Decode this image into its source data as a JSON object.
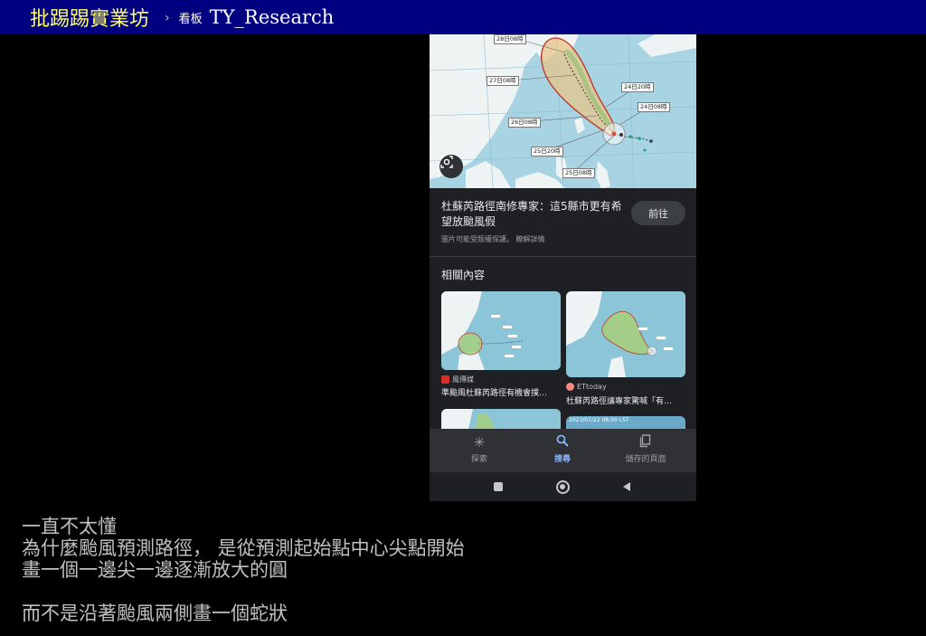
{
  "header": {
    "site_name": "批踢踢實業坊",
    "separator": "›",
    "board_label": "看板",
    "board_name": "TY_Research"
  },
  "phone_screenshot": {
    "map_labels": [
      "28日08時",
      "27日08時",
      "24日20時",
      "24日08時",
      "26日08時",
      "25日20時",
      "25日08時"
    ],
    "result_title": "杜蘇芮路徑南修專家：這5縣市更有希望放颱風假",
    "go_button": "前往",
    "copyright_note": "圖片可能受版權保護。 瞭解詳情",
    "related_heading": "相關內容",
    "cards": [
      {
        "source": "風傳媒",
        "title": "準颱風杜蘇芮路徑有機會撲…",
        "source_color": "#d93025"
      },
      {
        "source": "ETtoday",
        "title": "杜蘇芮路徑讓專家驚喊「有…",
        "source_color": "#f28b82"
      }
    ],
    "partial_card_text": "2023/07/22 08:00 LST",
    "bottom_nav": [
      {
        "label": "探索",
        "icon": "asterisk-icon"
      },
      {
        "label": "搜尋",
        "icon": "search-icon"
      },
      {
        "label": "儲存的頁面",
        "icon": "saved-pages-icon"
      }
    ],
    "colors": {
      "accent": "#8ab4f8",
      "cone": "#d4a74a",
      "track": "#333333"
    }
  },
  "post": {
    "lines": [
      "一直不太懂",
      "為什麼颱風預測路徑， 是從預測起始點中心尖點開始",
      "畫一個一邊尖一邊逐漸放大的圓",
      "",
      "而不是沿著颱風兩側畫一個蛇狀"
    ]
  }
}
